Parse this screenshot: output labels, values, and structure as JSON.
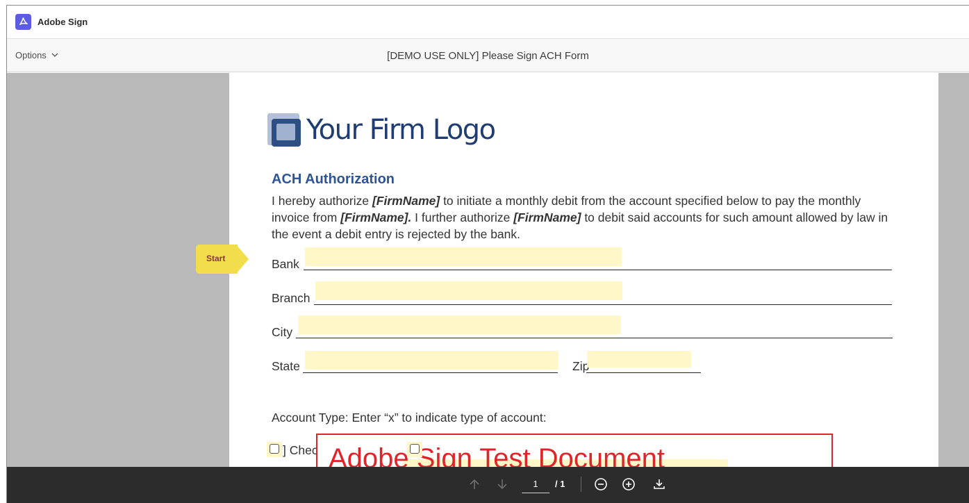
{
  "app": {
    "name": "Adobe Sign",
    "icon": "acrobat-icon",
    "brand_color": "#5c5ce0"
  },
  "subbar": {
    "options_label": "Options",
    "document_title": "[DEMO USE ONLY] Please Sign ACH Form"
  },
  "document": {
    "logo_text": "Your Firm Logo",
    "heading": "ACH Authorization",
    "paragraph": {
      "p1": "I hereby authorize ",
      "firm1": "[FirmName]",
      "p2": " to initiate a monthly debit from the account specified below to pay the monthly invoice from ",
      "firm2": "[FirmName].",
      "p3": " I further authorize ",
      "firm3": "[FirmName]",
      "p4": " to debit said accounts for such amount allowed by law in the event a debit entry is rejected by the bank."
    },
    "fields": {
      "bank_label": "Bank",
      "branch_label": "Branch",
      "city_label": "City",
      "state_label": "State",
      "zip_label": "Zip"
    },
    "account_type_label": "Account Type:    Enter “x” to indicate type of account:",
    "checking_partial": "] Chec",
    "watermark_text": "Adobe Sign Test Document",
    "start_label": "Start",
    "field_highlight_color": "#fff7c8",
    "watermark_color": "#e0242a"
  },
  "toolbar": {
    "current_page": "1",
    "total_pages": "/ 1",
    "icons": [
      "arrow-up-icon",
      "arrow-down-icon",
      "zoom-out-icon",
      "zoom-in-icon",
      "download-icon"
    ]
  }
}
